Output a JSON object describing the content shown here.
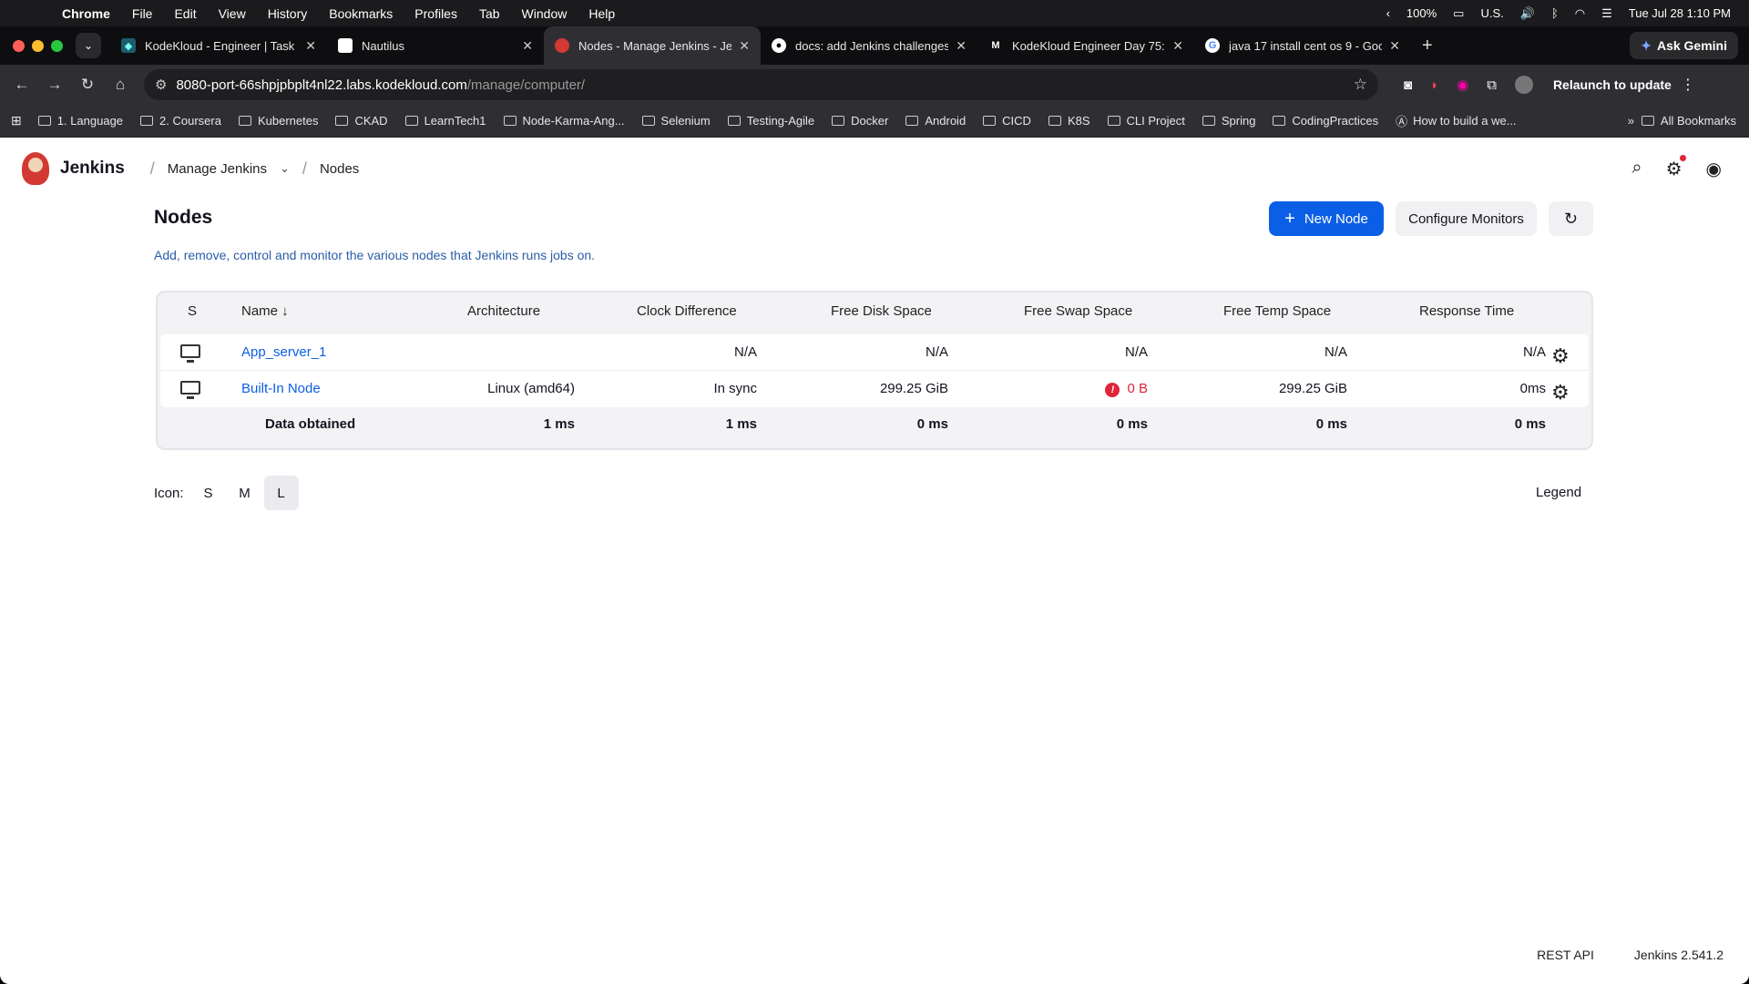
{
  "menubar": {
    "app": "Chrome",
    "items": [
      "File",
      "Edit",
      "View",
      "History",
      "Bookmarks",
      "Profiles",
      "Tab",
      "Window",
      "Help"
    ],
    "battery": "100%",
    "input": "U.S.",
    "clock": "Tue Jul 28  1:10 PM"
  },
  "tabs": [
    {
      "title": "KodeKloud - Engineer | Task",
      "active": false
    },
    {
      "title": "Nautilus",
      "active": false
    },
    {
      "title": "Nodes - Manage Jenkins - Je",
      "active": true
    },
    {
      "title": "docs: add Jenkins challenges",
      "active": false
    },
    {
      "title": "KodeKloud Engineer Day 75:",
      "active": false
    },
    {
      "title": "java 17 install cent os 9 - Goo",
      "active": false
    }
  ],
  "gemini": "Ask Gemini",
  "address": {
    "host": "8080-port-66shpjpbplt4nl22.labs.kodekloud.com",
    "path": "/manage/computer/",
    "relaunch": "Relaunch to update"
  },
  "bookmarks": [
    "1. Language",
    "2. Coursera",
    "Kubernetes",
    "CKAD",
    "LearnTech1",
    "Node-Karma-Ang...",
    "Selenium",
    "Testing-Agile",
    "Docker",
    "Android",
    "CICD",
    "K8S",
    "CLI Project",
    "Spring",
    "CodingPractices",
    "How to build a we..."
  ],
  "bookmarks_all": "All Bookmarks",
  "jenkins": {
    "brand": "Jenkins",
    "breadcrumb": [
      "Manage Jenkins",
      "Nodes"
    ],
    "title": "Nodes",
    "subtitle": "Add, remove, control and monitor the various nodes that Jenkins runs jobs on.",
    "new_node": "New Node",
    "configure_monitors": "Configure Monitors",
    "columns": [
      "S",
      "Name ↓",
      "Architecture",
      "Clock Difference",
      "Free Disk Space",
      "Free Swap Space",
      "Free Temp Space",
      "Response Time"
    ],
    "rows": [
      {
        "name": "App_server_1",
        "arch": "",
        "clock": "N/A",
        "disk": "N/A",
        "swap": "N/A",
        "temp": "N/A",
        "resp": "N/A"
      },
      {
        "name": "Built-In Node",
        "arch": "Linux (amd64)",
        "clock": "In sync",
        "disk": "299.25 GiB",
        "swap": "0 B",
        "temp": "299.25 GiB",
        "resp": "0ms"
      }
    ],
    "footer_row": {
      "label": "Data obtained",
      "arch": "1 ms",
      "clock": "1 ms",
      "disk": "0 ms",
      "swap": "0 ms",
      "temp": "0 ms",
      "resp": "0 ms"
    },
    "icon_label": "Icon:",
    "icon_sizes": [
      "S",
      "M",
      "L"
    ],
    "selected_size": "L",
    "legend": "Legend",
    "rest_api": "REST API",
    "version": "Jenkins 2.541.2"
  },
  "colors": {
    "primary": "#0b5ee6",
    "error": "#e0243a"
  }
}
